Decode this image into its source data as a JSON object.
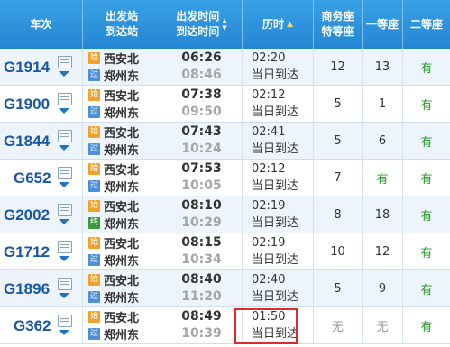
{
  "header": {
    "train_no": "车次",
    "dep_station": "出发站",
    "arr_station": "到达站",
    "dep_time": "出发时间",
    "arr_time": "到达时间",
    "duration": "历时",
    "business_1": "商务座",
    "business_2": "特等座",
    "first_class": "一等座",
    "second_class": "二等座"
  },
  "rows": [
    {
      "train": "G1914",
      "from_badge": "始",
      "from": "西安北",
      "to_badge": "过",
      "to": "郑州东",
      "dep": "06:26",
      "arr": "08:46",
      "dur": "02:20",
      "arrive_note": "当日到达",
      "business": "12",
      "first": "13",
      "second": "有"
    },
    {
      "train": "G1900",
      "from_badge": "始",
      "from": "西安北",
      "to_badge": "过",
      "to": "郑州东",
      "dep": "07:38",
      "arr": "09:50",
      "dur": "02:12",
      "arrive_note": "当日到达",
      "business": "5",
      "first": "1",
      "second": "有"
    },
    {
      "train": "G1844",
      "from_badge": "始",
      "from": "西安北",
      "to_badge": "过",
      "to": "郑州东",
      "dep": "07:43",
      "arr": "10:24",
      "dur": "02:41",
      "arrive_note": "当日到达",
      "business": "5",
      "first": "6",
      "second": "有"
    },
    {
      "train": "G652",
      "from_badge": "始",
      "from": "西安北",
      "to_badge": "过",
      "to": "郑州东",
      "dep": "07:53",
      "arr": "10:05",
      "dur": "02:12",
      "arrive_note": "当日到达",
      "business": "7",
      "first": "有",
      "second": "有"
    },
    {
      "train": "G2002",
      "from_badge": "始",
      "from": "西安北",
      "to_badge": "终",
      "to": "郑州东",
      "dep": "08:10",
      "arr": "10:29",
      "dur": "02:19",
      "arrive_note": "当日到达",
      "business": "8",
      "first": "18",
      "second": "有"
    },
    {
      "train": "G1712",
      "from_badge": "始",
      "from": "西安北",
      "to_badge": "过",
      "to": "郑州东",
      "dep": "08:15",
      "arr": "10:34",
      "dur": "02:19",
      "arrive_note": "当日到达",
      "business": "10",
      "first": "12",
      "second": "有"
    },
    {
      "train": "G1896",
      "from_badge": "始",
      "from": "西安北",
      "to_badge": "过",
      "to": "郑州东",
      "dep": "08:40",
      "arr": "11:20",
      "dur": "02:40",
      "arrive_note": "当日到达",
      "business": "5",
      "first": "9",
      "second": "有"
    },
    {
      "train": "G362",
      "from_badge": "始",
      "from": "西安北",
      "to_badge": "过",
      "to": "郑州东",
      "dep": "08:49",
      "arr": "10:39",
      "dur": "01:50",
      "arrive_note": "当日到达",
      "business": "无",
      "first": "无",
      "second": "有"
    }
  ],
  "colors": {
    "header_bg": "#2386d2",
    "train_link": "#1a56a8",
    "available": "#1e9b1e",
    "badge_start": "#f0a22a",
    "badge_pass": "#4d90d9",
    "badge_end": "#3b9a3b",
    "highlight_box": "#e0292b"
  }
}
